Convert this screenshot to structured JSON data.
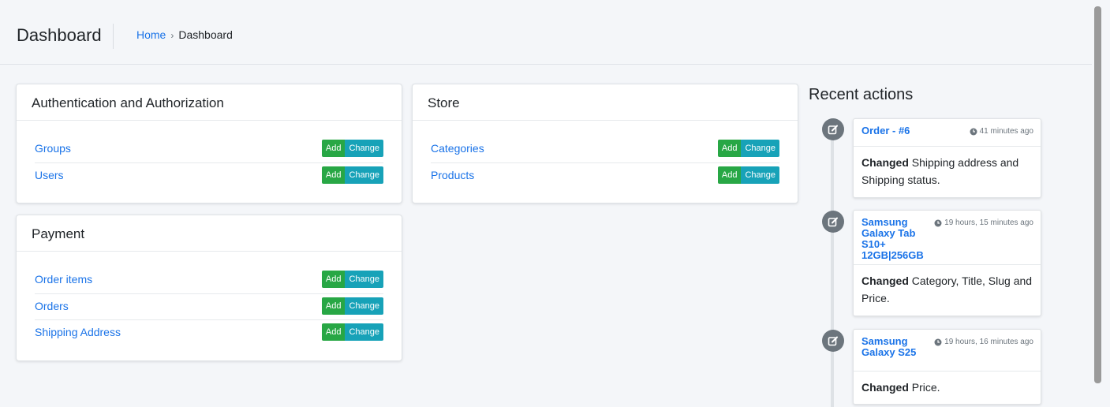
{
  "header": {
    "title": "Dashboard",
    "breadcrumb": {
      "home": "Home",
      "separator": "›",
      "current": "Dashboard"
    }
  },
  "buttons": {
    "add": "Add",
    "change": "Change"
  },
  "apps": [
    {
      "name": "Authentication and Authorization",
      "models": [
        "Groups",
        "Users"
      ]
    },
    {
      "name": "Payment",
      "models": [
        "Order items",
        "Orders",
        "Shipping Address"
      ]
    },
    {
      "name": "Store",
      "models": [
        "Categories",
        "Products"
      ]
    }
  ],
  "recent": {
    "title": "Recent actions",
    "items": [
      {
        "name": "Order - #6",
        "time": "41 minutes ago",
        "action": "Changed",
        "detail": "Shipping address and Shipping status."
      },
      {
        "name": "Samsung Galaxy Tab S10+ 12GB|256GB",
        "time": "19 hours, 15 minutes ago",
        "action": "Changed",
        "detail": "Category, Title, Slug and Price."
      },
      {
        "name": "Samsung Galaxy S25",
        "time": "19 hours, 16 minutes ago",
        "action": "Changed",
        "detail": "Price."
      }
    ]
  },
  "colors": {
    "link": "#1a73e8",
    "add": "#28a745",
    "change": "#17a2b8",
    "icon_bg": "#6c757d"
  }
}
